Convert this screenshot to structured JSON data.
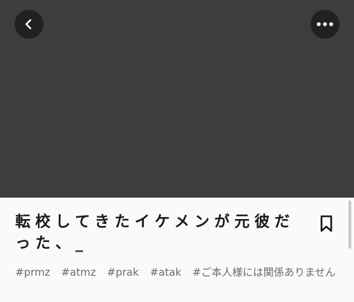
{
  "header": {
    "back_icon": "chevron-left-icon",
    "more_icon": "more-horizontal-icon"
  },
  "story": {
    "title": "転校してきたイケメンが元彼だった、_",
    "bookmark_icon": "bookmark-icon",
    "tags": [
      "#prmz",
      "#atmz",
      "#prak",
      "#atak",
      "#ご本人様には関係ありません"
    ]
  },
  "colors": {
    "cover": "#3d3d3d",
    "sheet": "#fafafa",
    "title": "#1a1a1a",
    "tag": "#6b6b6b"
  }
}
